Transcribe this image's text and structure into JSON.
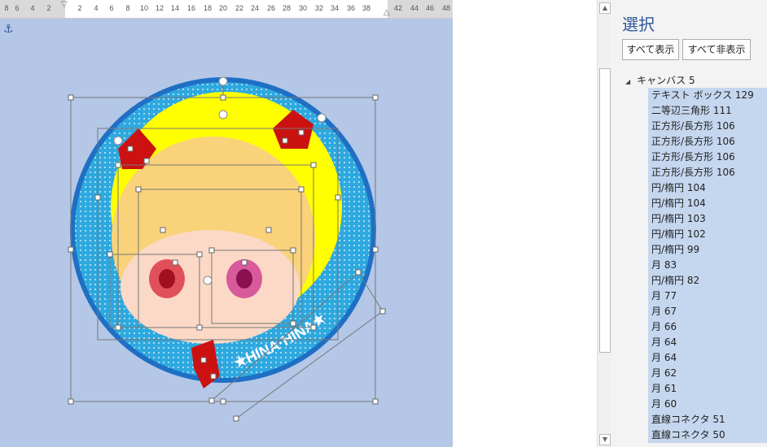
{
  "ruler": {
    "ticks": [
      "8",
      "6",
      "4",
      "2",
      "2",
      "4",
      "6",
      "8",
      "10",
      "12",
      "14",
      "16",
      "18",
      "20",
      "22",
      "24",
      "26",
      "28",
      "30",
      "32",
      "34",
      "36",
      "38",
      "42",
      "44",
      "46",
      "48"
    ]
  },
  "canvas": {
    "badge_text": "★HINA·HINA★",
    "colors": {
      "background": "#b4c7e7",
      "outer_ring": "#1f6fc5",
      "dot_fill": "#2ea9df",
      "moon": "#ffff00",
      "hair": "#f9d27a",
      "face": "#fbd9c6",
      "bow": "#cc1111",
      "handle": "#ffffff",
      "line": "#666666"
    }
  },
  "pane": {
    "title": "選択",
    "show_all": "すべて表示",
    "hide_all": "すべて非表示",
    "root_label": "キャンバス 5",
    "items": [
      "テキスト ボックス 129",
      "二等辺三角形 111",
      "正方形/長方形 106",
      "正方形/長方形 106",
      "正方形/長方形 106",
      "正方形/長方形 106",
      "円/楕円 104",
      "円/楕円 104",
      "円/楕円 103",
      "円/楕円 102",
      "円/楕円 99",
      "月 83",
      "円/楕円 82",
      "月 77",
      "月 67",
      "月 66",
      "月 64",
      "月 64",
      "月 62",
      "月 61",
      "月 60",
      "直線コネクタ 51",
      "直線コネクタ 50"
    ]
  }
}
